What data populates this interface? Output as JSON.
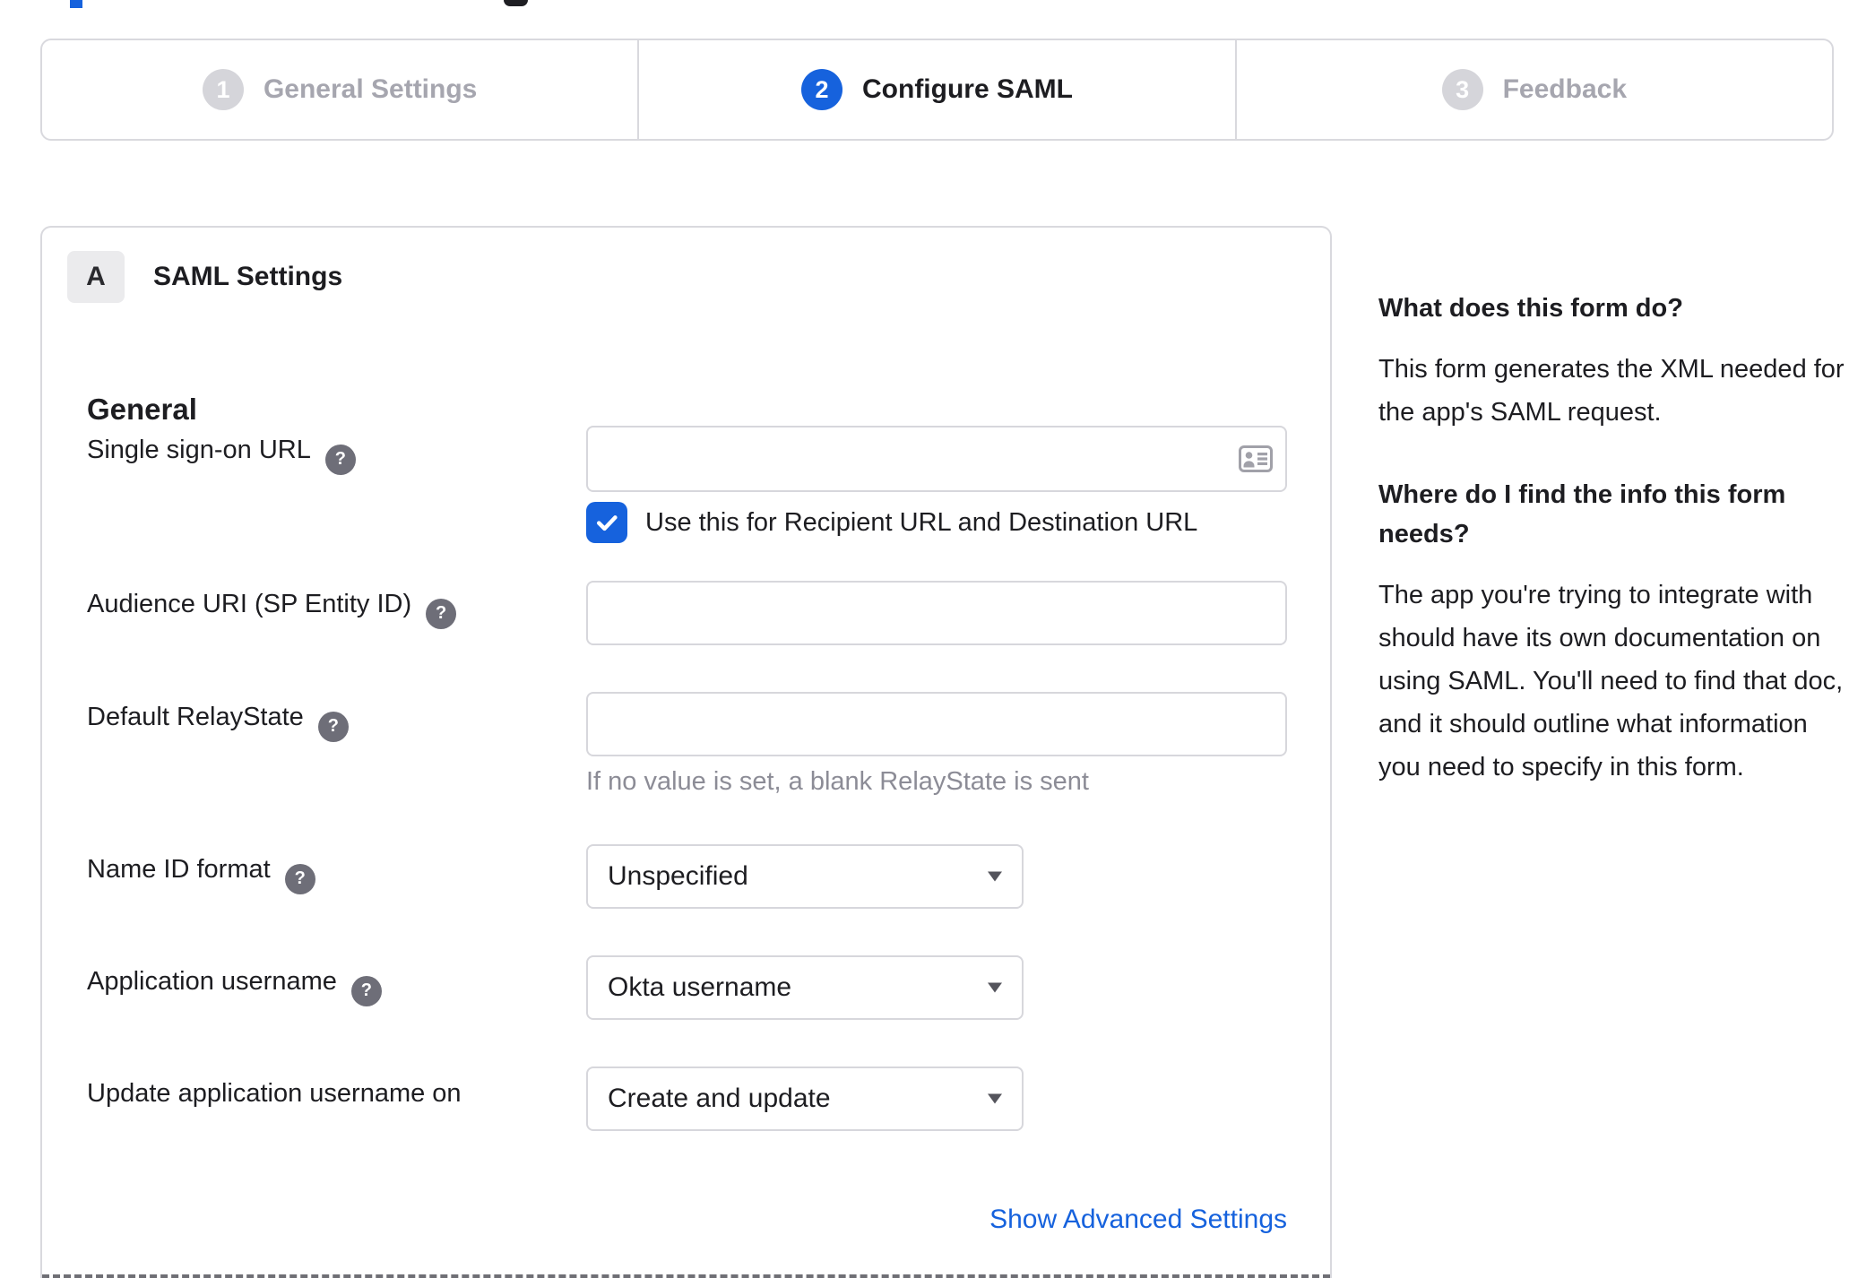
{
  "colors": {
    "accent_blue": "#1662dd",
    "inactive_gray": "#a6a6af",
    "border_gray": "#d7d7dc",
    "helper_gray": "#8c8c96",
    "text": "#1d1d21"
  },
  "stepper": {
    "steps": [
      {
        "number": "1",
        "label": "General Settings",
        "active": false
      },
      {
        "number": "2",
        "label": "Configure SAML",
        "active": true
      },
      {
        "number": "3",
        "label": "Feedback",
        "active": false
      }
    ]
  },
  "panel": {
    "section_badge": "A",
    "section_title": "SAML Settings",
    "group_title": "General",
    "fields": {
      "sso": {
        "label": "Single sign-on URL",
        "value": "",
        "checkbox_label": "Use this for Recipient URL and Destination URL",
        "checkbox_checked": true
      },
      "audience": {
        "label": "Audience URI (SP Entity ID)",
        "value": ""
      },
      "relay": {
        "label": "Default RelayState",
        "value": "",
        "helper": "If no value is set, a blank RelayState is sent"
      },
      "name_id": {
        "label": "Name ID format",
        "value": "Unspecified"
      },
      "app_username": {
        "label": "Application username",
        "value": "Okta username"
      },
      "update_username": {
        "label": "Update application username on",
        "value": "Create and update"
      }
    },
    "advanced_link": "Show Advanced Settings"
  },
  "help_panel": {
    "q1": "What does this form do?",
    "a1": "This form generates the XML needed for the app's SAML request.",
    "q2": "Where do I find the info this form needs?",
    "a2": "The app you're trying to integrate with should have its own documentation on using SAML. You'll need to find that doc, and it should outline what information you need to specify in this form."
  }
}
